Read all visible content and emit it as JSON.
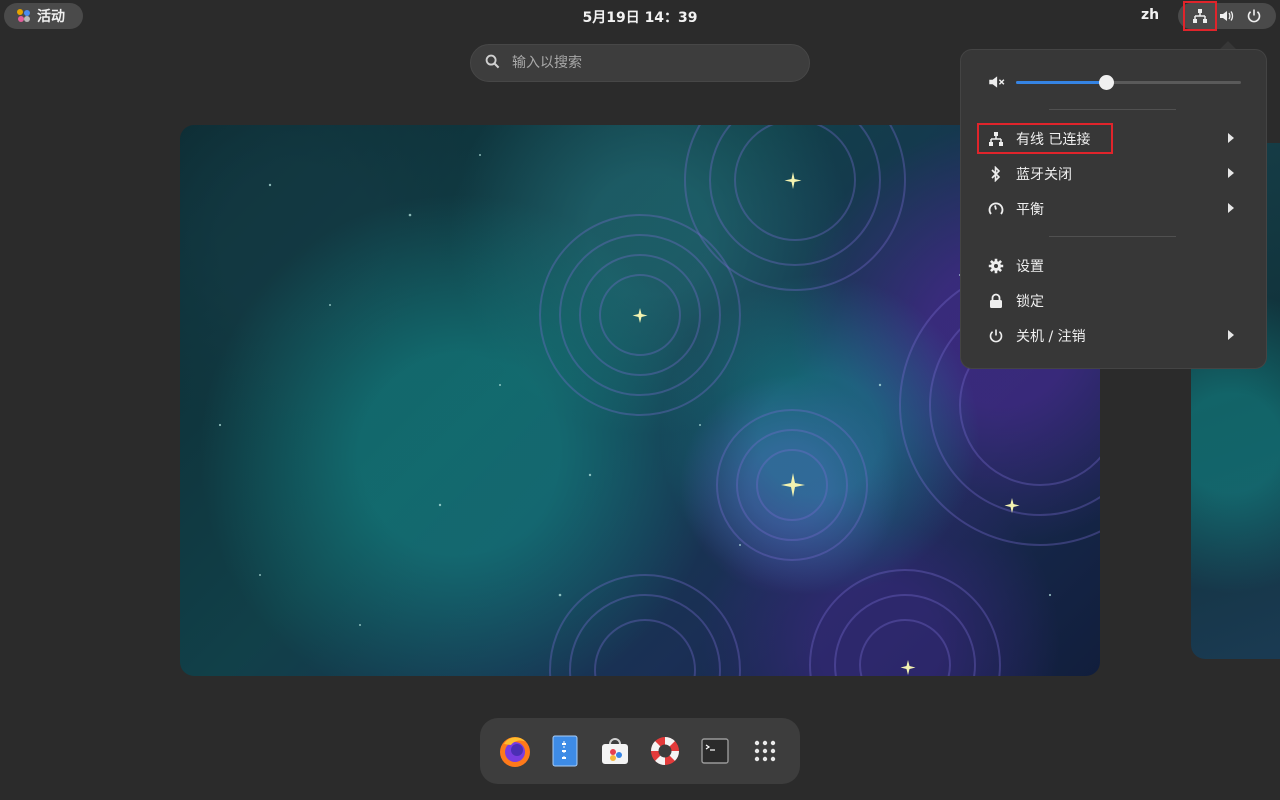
{
  "topbar": {
    "activities_label": "活动",
    "clock": "5月19日 14：39",
    "language": "zh",
    "tray_icons": [
      "network-wired-icon",
      "volume-icon",
      "power-icon"
    ]
  },
  "search": {
    "placeholder": "输入以搜索"
  },
  "dash": {
    "apps": [
      "firefox-icon",
      "text-editor-icon",
      "software-center-icon",
      "help-icon",
      "terminal-icon",
      "show-apps-icon"
    ]
  },
  "system_menu": {
    "volume_level": 0.4,
    "items": [
      {
        "label": "有线 已连接",
        "icon": "network-wired-icon",
        "submenu": true
      },
      {
        "label": "蓝牙关闭",
        "icon": "bluetooth-icon",
        "submenu": true
      },
      {
        "label": "平衡",
        "icon": "power-profile-icon",
        "submenu": true
      },
      {
        "label": "设置",
        "icon": "gear-icon",
        "submenu": false
      },
      {
        "label": "锁定",
        "icon": "lock-icon",
        "submenu": false
      },
      {
        "label": "关机 / 注销",
        "icon": "power-icon",
        "submenu": true
      }
    ]
  },
  "colors": {
    "accent": "#3584e4",
    "highlight": "#e0242b",
    "panel": "#373737"
  }
}
